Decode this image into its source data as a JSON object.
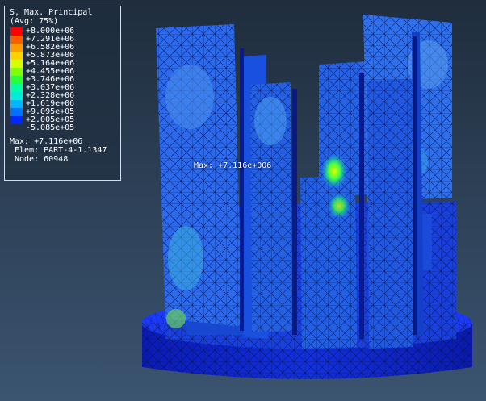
{
  "legend": {
    "title": "S, Max. Principal",
    "subtitle": "(Avg: 75%)",
    "entries": [
      {
        "value": "+8.000e+06",
        "color": "#ff0000"
      },
      {
        "value": "+7.291e+06",
        "color": "#ff5a00"
      },
      {
        "value": "+6.582e+06",
        "color": "#ff9c00"
      },
      {
        "value": "+5.873e+06",
        "color": "#ffd200"
      },
      {
        "value": "+5.164e+06",
        "color": "#d6ff00"
      },
      {
        "value": "+4.455e+06",
        "color": "#80ff00"
      },
      {
        "value": "+3.746e+06",
        "color": "#2cff36"
      },
      {
        "value": "+3.037e+06",
        "color": "#00ffa0"
      },
      {
        "value": "+2.328e+06",
        "color": "#00ecd8"
      },
      {
        "value": "+1.619e+06",
        "color": "#00b8ff"
      },
      {
        "value": "+9.095e+05",
        "color": "#0070ff"
      },
      {
        "value": "+2.005e+05",
        "color": "#0028ff"
      },
      {
        "value": "-5.085e+05",
        "color": "#0000c8"
      }
    ],
    "max_line": "Max: +7.116e+06",
    "elem_line": "Elem: PART-4-1.1347",
    "node_line": "Node: 60948"
  },
  "model": {
    "max_label": "Max: +7.116e+006"
  },
  "colors": {
    "contour_low": "#0a1fd0",
    "contour_mid": "#1a55e8",
    "contour_high": "#00c8ff",
    "background_top": "#1f2d3d",
    "background_bottom": "#3b5470"
  }
}
